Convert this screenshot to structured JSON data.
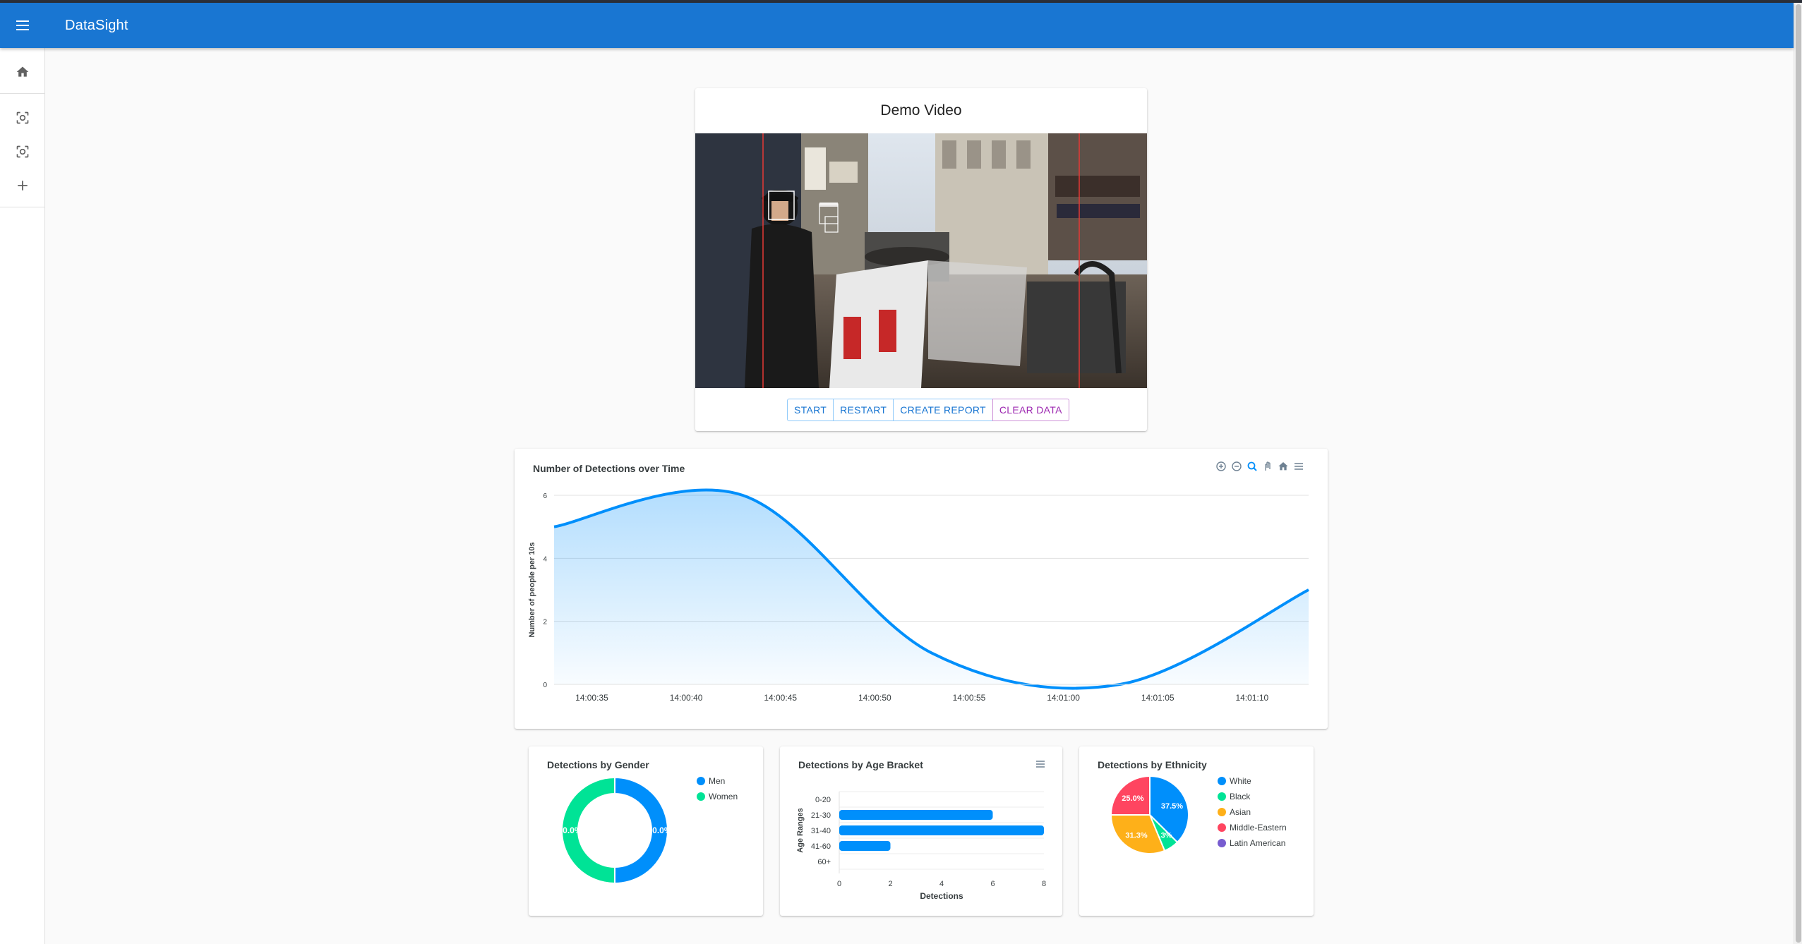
{
  "app": {
    "title": "DataSight"
  },
  "sidebar": {
    "items": [
      {
        "icon": "home-icon"
      },
      {
        "icon": "face-scan-icon"
      },
      {
        "icon": "face-scan-icon"
      },
      {
        "icon": "add-icon"
      }
    ]
  },
  "video_card": {
    "title": "Demo Video",
    "buttons": {
      "start": "START",
      "restart": "RESTART",
      "create_report": "CREATE REPORT",
      "clear_data": "CLEAR DATA"
    }
  },
  "colors": {
    "primary": "#1976d2",
    "series_blue": "#008ffb",
    "green": "#00e396",
    "orange": "#feb019",
    "red": "#ff4560",
    "purple": "#775dd0"
  },
  "chart_data": [
    {
      "type": "area",
      "title": "Number of Detections over Time",
      "ylabel": "Number of people per 10s",
      "ylim": [
        0,
        6
      ],
      "yticks": [
        "0",
        "2",
        "4",
        "6"
      ],
      "xticks": [
        "14:00:35",
        "14:00:40",
        "14:00:45",
        "14:00:50",
        "14:00:55",
        "14:01:00",
        "14:01:05",
        "14:01:10"
      ],
      "x": [
        "14:00:33",
        "14:00:43",
        "14:00:53",
        "14:01:03",
        "14:01:13"
      ],
      "series": [
        {
          "values": [
            5,
            6,
            1,
            0,
            3
          ]
        }
      ],
      "toolbar": [
        "zoom-in-icon",
        "zoom-out-icon",
        "zoom-select-icon",
        "pan-icon",
        "reset-home-icon",
        "menu-icon"
      ]
    },
    {
      "type": "pie",
      "variant": "donut",
      "title": "Detections by Gender",
      "categories": [
        "Men",
        "Women"
      ],
      "values": [
        50.0,
        50.0
      ],
      "labels": [
        "50.0%",
        "50.0%"
      ]
    },
    {
      "type": "bar",
      "orientation": "horizontal",
      "title": "Detections by Age Bracket",
      "categories": [
        "0-20",
        "21-30",
        "31-40",
        "41-60",
        "60+"
      ],
      "values": [
        0,
        6,
        8,
        2,
        0
      ],
      "xlabel": "Detections",
      "ylabel": "Age Ranges",
      "xticks": [
        "0",
        "2",
        "4",
        "6",
        "8"
      ],
      "xlim": [
        0,
        8
      ]
    },
    {
      "type": "pie",
      "title": "Detections by Ethnicity",
      "categories": [
        "White",
        "Black",
        "Asian",
        "Middle-Eastern",
        "Latin American"
      ],
      "values": [
        37.5,
        6.3,
        31.3,
        25.0,
        0
      ],
      "labels": [
        "37.5%",
        "6.3%",
        "31.3%",
        "25.0%",
        ""
      ]
    }
  ]
}
